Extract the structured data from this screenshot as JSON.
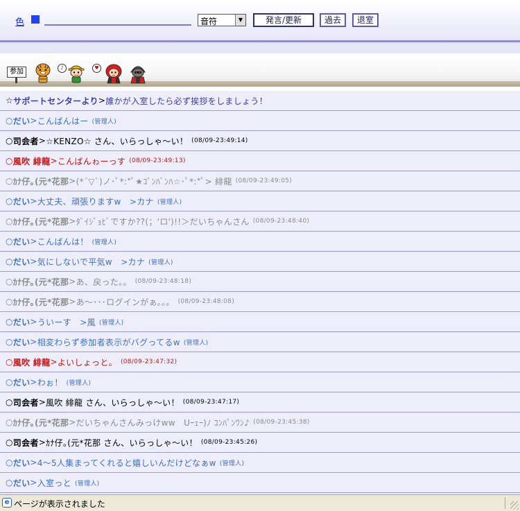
{
  "form": {
    "color_label": "色",
    "color_swatch": "#2244ee",
    "message_value": "",
    "sound_selected": "音符",
    "send_label": "発言/更新",
    "past_label": "過去",
    "exit_label": "退室"
  },
  "members": {
    "join_label": "参加",
    "avatars": [
      {
        "icon": "tiger-avatar-icon",
        "color": "#f0a020"
      },
      {
        "icon": "cap-boy-avatar-icon",
        "color": "#f5c400"
      },
      {
        "icon": "red-hair-girl-avatar-icon",
        "color": "#d91c1c"
      },
      {
        "icon": "dark-knight-avatar-icon",
        "color": "#444444"
      }
    ]
  },
  "chat": {
    "rows": [
      {
        "style": "system",
        "prefix": "☆",
        "name": "サポートセンターより",
        "sep": " > ",
        "msg": "誰かが入室したら必ず挨拶をしましょう！",
        "tag": "",
        "time": ""
      },
      {
        "style": "blue",
        "prefix": "○ ",
        "name": "だい",
        "sep": " > ",
        "msg": "こんばんはー",
        "tag": "(管理人)",
        "time": ""
      },
      {
        "style": "black",
        "prefix": "○",
        "name": "司会者",
        "sep": " > ",
        "msg": "☆KENZO☆ さん、いらっしゃ～い！",
        "tag": "",
        "time": "(08/09-23:49:14)"
      },
      {
        "style": "red",
        "prefix": "○ ",
        "name": "風吹 緋龍",
        "sep": " > ",
        "msg": "こんばんゎーっす",
        "tag": "",
        "time": "(08/09-23:49:13)"
      },
      {
        "style": "gray",
        "prefix": "○ ",
        "name": "ｶﾅ仔｡(元*花那",
        "sep": " > ",
        "msg": "(*´▽`)ノ･ﾟ*:*ﾟ★ｺﾞﾝﾊﾞﾝﾊ☆･ﾟ*:*ﾟ> 緋龍",
        "tag": "",
        "time": "(08/09-23:49:05)"
      },
      {
        "style": "blue",
        "prefix": "○ ",
        "name": "だい",
        "sep": " > ",
        "msg": "大丈夫、頑張りますw　>カナ",
        "tag": "(管理人)",
        "time": ""
      },
      {
        "style": "gray",
        "prefix": "○ ",
        "name": "ｶﾅ仔｡(元*花那",
        "sep": " > ",
        "msg": "ﾀﾞｲｼﾞｮﾋﾞですか??(；'ロ')!!＞だいちゃんさん",
        "tag": "",
        "time": "(08/09-23:48:40)"
      },
      {
        "style": "blue",
        "prefix": "○ ",
        "name": "だい",
        "sep": " > ",
        "msg": "こんばんは！",
        "tag": "(管理人)",
        "time": ""
      },
      {
        "style": "blue",
        "prefix": "○ ",
        "name": "だい",
        "sep": " > ",
        "msg": "気にしないで平気w　>カナ",
        "tag": "(管理人)",
        "time": ""
      },
      {
        "style": "gray",
        "prefix": "○ ",
        "name": "ｶﾅ仔｡(元*花那",
        "sep": " > ",
        "msg": "あ、戻った。。",
        "tag": "",
        "time": "(08/09-23:48:18)"
      },
      {
        "style": "gray",
        "prefix": "○ ",
        "name": "ｶﾅ仔｡(元*花那",
        "sep": " > ",
        "msg": "あ～･･･ログインがぁ。。。",
        "tag": "",
        "time": "(08/09-23:48:08)"
      },
      {
        "style": "blue",
        "prefix": "○ ",
        "name": "だい",
        "sep": " > ",
        "msg": "ういーす　>風",
        "tag": "(管理人)",
        "time": ""
      },
      {
        "style": "blue",
        "prefix": "○ ",
        "name": "だい",
        "sep": " > ",
        "msg": "相変わらず参加者表示がバグってるw",
        "tag": "(管理人)",
        "time": ""
      },
      {
        "style": "red",
        "prefix": "○ ",
        "name": "風吹 緋龍",
        "sep": " > ",
        "msg": "よいしょっと。",
        "tag": "",
        "time": "(08/09-23:47:32)"
      },
      {
        "style": "blue",
        "prefix": "○ ",
        "name": "だい",
        "sep": " > ",
        "msg": "わぉ！",
        "tag": "(管理人)",
        "time": ""
      },
      {
        "style": "black",
        "prefix": "○",
        "name": "司会者",
        "sep": " > ",
        "msg": "風吹 緋龍 さん、いらっしゃ～い！",
        "tag": "",
        "time": "(08/09-23:47:17)"
      },
      {
        "style": "gray",
        "prefix": "○ ",
        "name": "ｶﾅ仔｡(元*花那",
        "sep": " > ",
        "msg": "だいちゃんさんみっけww　Uｰｪｰ)ﾉ ｺﾝﾊﾞﾝﾜﾝ♪",
        "tag": "",
        "time": "(08/09-23:45:38)"
      },
      {
        "style": "black",
        "prefix": "○",
        "name": "司会者",
        "sep": " > ",
        "msg": "ｶﾅ仔｡(元*花那 さん、いらっしゃ～い！",
        "tag": "",
        "time": "(08/09-23:45:26)"
      },
      {
        "style": "blue",
        "prefix": "○ ",
        "name": "だい",
        "sep": " > ",
        "msg": "4～5人集まってくれると嬉しいんだけどなぁw",
        "tag": "(管理人)",
        "time": ""
      },
      {
        "style": "blue",
        "prefix": "○ ",
        "name": "だい",
        "sep": " > ",
        "msg": "入室っと",
        "tag": "(管理人)",
        "time": ""
      }
    ]
  },
  "status": {
    "text": "ページが表示されました",
    "icon": "ie-page-icon"
  }
}
